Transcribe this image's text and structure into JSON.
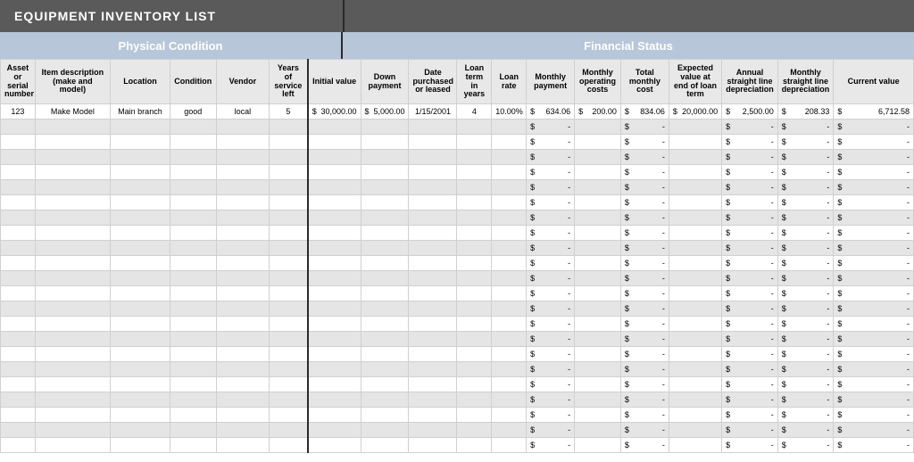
{
  "title": "EQUIPMENT INVENTORY LIST",
  "groups": {
    "physical": "Physical Condition",
    "financial": "Financial Status"
  },
  "headers": [
    "Asset or serial number",
    "Item description (make and model)",
    "Location",
    "Condition",
    "Vendor",
    "Years of service left",
    "Initial value",
    "Down payment",
    "Date purchased or leased",
    "Loan term in years",
    "Loan rate",
    "Monthly payment",
    "Monthly operating costs",
    "Total monthly cost",
    "Expected value at end of loan term",
    "Annual straight line depreciation",
    "Monthly straight line depreciation",
    "Current value"
  ],
  "col_classes": [
    "c-asset",
    "c-item",
    "c-loc",
    "c-cond",
    "c-vendor",
    "c-years",
    "c-initval",
    "c-down",
    "c-date",
    "c-term",
    "c-rate",
    "c-mpay",
    "c-mop",
    "c-tot",
    "c-exp",
    "c-ann",
    "c-mdep",
    "c-cur"
  ],
  "money_cols": [
    6,
    7,
    11,
    12,
    13,
    14,
    15,
    16,
    17
  ],
  "rows": [
    [
      "123",
      "Make Model",
      "Main branch",
      "good",
      "local",
      "5",
      "$   30,000.00",
      "$   5,000.00",
      "1/15/2001",
      "4",
      "10.00%",
      "$      634.06",
      "$    200.00",
      "$      834.06",
      "$ 20,000.00",
      "$      2,500.00",
      "$         208.33",
      "$              6,712.58"
    ],
    [
      "",
      "",
      "",
      "",
      "",
      "",
      "",
      "",
      "",
      "",
      "",
      "$             -",
      "",
      "$             -",
      "",
      "$                  -",
      "$                  -",
      "$                          -"
    ],
    [
      "",
      "",
      "",
      "",
      "",
      "",
      "",
      "",
      "",
      "",
      "",
      "$             -",
      "",
      "$             -",
      "",
      "$                  -",
      "$                  -",
      "$                          -"
    ],
    [
      "",
      "",
      "",
      "",
      "",
      "",
      "",
      "",
      "",
      "",
      "",
      "$             -",
      "",
      "$             -",
      "",
      "$                  -",
      "$                  -",
      "$                          -"
    ],
    [
      "",
      "",
      "",
      "",
      "",
      "",
      "",
      "",
      "",
      "",
      "",
      "$             -",
      "",
      "$             -",
      "",
      "$                  -",
      "$                  -",
      "$                          -"
    ],
    [
      "",
      "",
      "",
      "",
      "",
      "",
      "",
      "",
      "",
      "",
      "",
      "$             -",
      "",
      "$             -",
      "",
      "$                  -",
      "$                  -",
      "$                          -"
    ],
    [
      "",
      "",
      "",
      "",
      "",
      "",
      "",
      "",
      "",
      "",
      "",
      "$             -",
      "",
      "$             -",
      "",
      "$                  -",
      "$                  -",
      "$                          -"
    ],
    [
      "",
      "",
      "",
      "",
      "",
      "",
      "",
      "",
      "",
      "",
      "",
      "$             -",
      "",
      "$             -",
      "",
      "$                  -",
      "$                  -",
      "$                          -"
    ],
    [
      "",
      "",
      "",
      "",
      "",
      "",
      "",
      "",
      "",
      "",
      "",
      "$             -",
      "",
      "$             -",
      "",
      "$                  -",
      "$                  -",
      "$                          -"
    ],
    [
      "",
      "",
      "",
      "",
      "",
      "",
      "",
      "",
      "",
      "",
      "",
      "$             -",
      "",
      "$             -",
      "",
      "$                  -",
      "$                  -",
      "$                          -"
    ],
    [
      "",
      "",
      "",
      "",
      "",
      "",
      "",
      "",
      "",
      "",
      "",
      "$             -",
      "",
      "$             -",
      "",
      "$                  -",
      "$                  -",
      "$                          -"
    ],
    [
      "",
      "",
      "",
      "",
      "",
      "",
      "",
      "",
      "",
      "",
      "",
      "$             -",
      "",
      "$             -",
      "",
      "$                  -",
      "$                  -",
      "$                          -"
    ],
    [
      "",
      "",
      "",
      "",
      "",
      "",
      "",
      "",
      "",
      "",
      "",
      "$             -",
      "",
      "$             -",
      "",
      "$                  -",
      "$                  -",
      "$                          -"
    ],
    [
      "",
      "",
      "",
      "",
      "",
      "",
      "",
      "",
      "",
      "",
      "",
      "$             -",
      "",
      "$             -",
      "",
      "$                  -",
      "$                  -",
      "$                          -"
    ],
    [
      "",
      "",
      "",
      "",
      "",
      "",
      "",
      "",
      "",
      "",
      "",
      "$             -",
      "",
      "$             -",
      "",
      "$                  -",
      "$                  -",
      "$                          -"
    ],
    [
      "",
      "",
      "",
      "",
      "",
      "",
      "",
      "",
      "",
      "",
      "",
      "$             -",
      "",
      "$             -",
      "",
      "$                  -",
      "$                  -",
      "$                          -"
    ],
    [
      "",
      "",
      "",
      "",
      "",
      "",
      "",
      "",
      "",
      "",
      "",
      "$             -",
      "",
      "$             -",
      "",
      "$                  -",
      "$                  -",
      "$                          -"
    ],
    [
      "",
      "",
      "",
      "",
      "",
      "",
      "",
      "",
      "",
      "",
      "",
      "$             -",
      "",
      "$             -",
      "",
      "$                  -",
      "$                  -",
      "$                          -"
    ],
    [
      "",
      "",
      "",
      "",
      "",
      "",
      "",
      "",
      "",
      "",
      "",
      "$             -",
      "",
      "$             -",
      "",
      "$                  -",
      "$                  -",
      "$                          -"
    ],
    [
      "",
      "",
      "",
      "",
      "",
      "",
      "",
      "",
      "",
      "",
      "",
      "$             -",
      "",
      "$             -",
      "",
      "$                  -",
      "$                  -",
      "$                          -"
    ],
    [
      "",
      "",
      "",
      "",
      "",
      "",
      "",
      "",
      "",
      "",
      "",
      "$             -",
      "",
      "$             -",
      "",
      "$                  -",
      "$                  -",
      "$                          -"
    ],
    [
      "",
      "",
      "",
      "",
      "",
      "",
      "",
      "",
      "",
      "",
      "",
      "$             -",
      "",
      "$             -",
      "",
      "$                  -",
      "$                  -",
      "$                          -"
    ],
    [
      "",
      "",
      "",
      "",
      "",
      "",
      "",
      "",
      "",
      "",
      "",
      "$             -",
      "",
      "$             -",
      "",
      "$                  -",
      "$                  -",
      "$                          -"
    ]
  ]
}
